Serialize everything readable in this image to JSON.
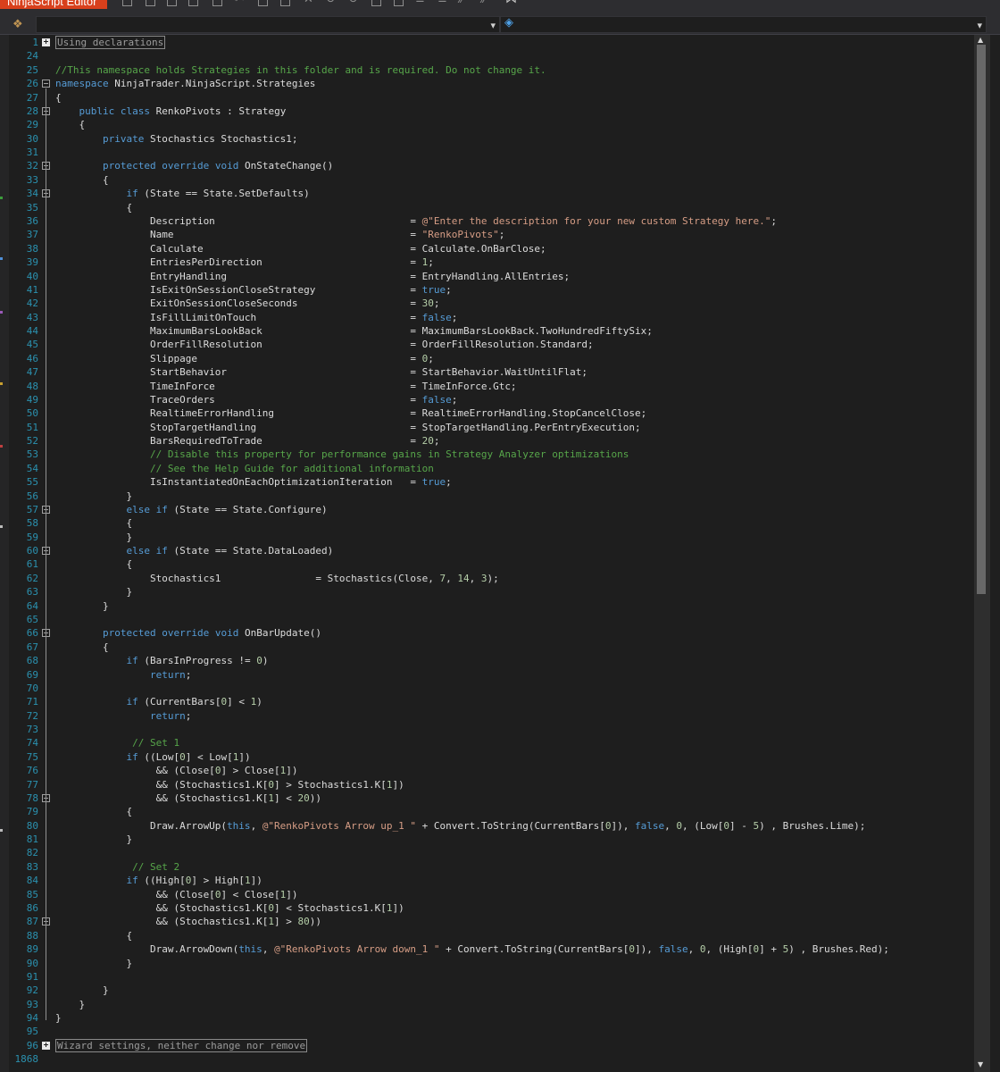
{
  "window": {
    "title": "NinjaScript Editor"
  },
  "toolbar_icons": [
    "new-icon",
    "open-icon",
    "save-icon",
    "save-all-icon",
    "templates-icon",
    "cut-icon",
    "copy-icon",
    "paste-icon",
    "delete-icon",
    "undo-icon",
    "redo-icon",
    "compile-icon",
    "calculator-icon",
    "comment-icon",
    "uncomment-icon",
    "indent-icon",
    "outdent-icon",
    "visual-studio-icon"
  ],
  "nav": {
    "left_icon": "class-icon",
    "member_icon": "method-icon"
  },
  "colors": {
    "keyword": "#569cd6",
    "comment": "#57a64a",
    "string": "#d69d85",
    "number": "#b5cea8",
    "line_number": "#2b91af",
    "text": "#dcdcdc",
    "background": "#1e1e1e",
    "title_accent": "#d8401c"
  },
  "code_lines": [
    {
      "n": "1",
      "fold": "plus",
      "t": [
        [
          "Using declarations",
          "collapsed"
        ]
      ]
    },
    {
      "n": "24",
      "t": []
    },
    {
      "n": "25",
      "t": [
        [
          "//This namespace holds Strategies in this folder and is required. Do not change it.",
          "cm"
        ]
      ]
    },
    {
      "n": "26",
      "fold": "minus",
      "t": [
        [
          "namespace",
          "kw"
        ],
        [
          " NinjaTrader.NinjaScript.Strategies",
          ""
        ]
      ]
    },
    {
      "n": "27",
      "t": [
        [
          "{",
          ""
        ]
      ]
    },
    {
      "n": "28",
      "fold": "minus",
      "t": [
        [
          "    ",
          ""
        ],
        [
          "public",
          "kw"
        ],
        [
          " ",
          ""
        ],
        [
          "class",
          "kw"
        ],
        [
          " RenkoPivots : Strategy",
          ""
        ]
      ]
    },
    {
      "n": "29",
      "t": [
        [
          "    {",
          ""
        ]
      ]
    },
    {
      "n": "30",
      "t": [
        [
          "        ",
          ""
        ],
        [
          "private",
          "kw"
        ],
        [
          " Stochastics Stochastics1;",
          ""
        ]
      ]
    },
    {
      "n": "31",
      "t": []
    },
    {
      "n": "32",
      "fold": "minus",
      "t": [
        [
          "        ",
          ""
        ],
        [
          "protected",
          "kw"
        ],
        [
          " ",
          ""
        ],
        [
          "override",
          "kw"
        ],
        [
          " ",
          ""
        ],
        [
          "void",
          "kw"
        ],
        [
          " OnStateChange()",
          ""
        ]
      ]
    },
    {
      "n": "33",
      "t": [
        [
          "        {",
          ""
        ]
      ]
    },
    {
      "n": "34",
      "fold": "minus",
      "t": [
        [
          "            ",
          ""
        ],
        [
          "if",
          "kw"
        ],
        [
          " (State == State.SetDefaults)",
          ""
        ]
      ]
    },
    {
      "n": "35",
      "t": [
        [
          "            {",
          ""
        ]
      ]
    },
    {
      "n": "36",
      "t": [
        [
          "                Description                                 = ",
          ""
        ],
        [
          "@\"Enter the description for your new custom Strategy here.\"",
          "st"
        ],
        [
          ";",
          ""
        ]
      ]
    },
    {
      "n": "37",
      "t": [
        [
          "                Name                                        = ",
          ""
        ],
        [
          "\"RenkoPivots\"",
          "st"
        ],
        [
          ";",
          ""
        ]
      ]
    },
    {
      "n": "38",
      "t": [
        [
          "                Calculate                                   = Calculate.OnBarClose;",
          ""
        ]
      ]
    },
    {
      "n": "39",
      "t": [
        [
          "                EntriesPerDirection                         = ",
          ""
        ],
        [
          "1",
          "nm"
        ],
        [
          ";",
          ""
        ]
      ]
    },
    {
      "n": "40",
      "t": [
        [
          "                EntryHandling                               = EntryHandling.AllEntries;",
          ""
        ]
      ]
    },
    {
      "n": "41",
      "t": [
        [
          "                IsExitOnSessionCloseStrategy                = ",
          ""
        ],
        [
          "true",
          "kw"
        ],
        [
          ";",
          ""
        ]
      ]
    },
    {
      "n": "42",
      "t": [
        [
          "                ExitOnSessionCloseSeconds                   = ",
          ""
        ],
        [
          "30",
          "nm"
        ],
        [
          ";",
          ""
        ]
      ]
    },
    {
      "n": "43",
      "t": [
        [
          "                IsFillLimitOnTouch                          = ",
          ""
        ],
        [
          "false",
          "kw"
        ],
        [
          ";",
          ""
        ]
      ]
    },
    {
      "n": "44",
      "t": [
        [
          "                MaximumBarsLookBack                         = MaximumBarsLookBack.TwoHundredFiftySix;",
          ""
        ]
      ]
    },
    {
      "n": "45",
      "t": [
        [
          "                OrderFillResolution                         = OrderFillResolution.Standard;",
          ""
        ]
      ]
    },
    {
      "n": "46",
      "t": [
        [
          "                Slippage                                    = ",
          ""
        ],
        [
          "0",
          "nm"
        ],
        [
          ";",
          ""
        ]
      ]
    },
    {
      "n": "47",
      "t": [
        [
          "                StartBehavior                               = StartBehavior.WaitUntilFlat;",
          ""
        ]
      ]
    },
    {
      "n": "48",
      "t": [
        [
          "                TimeInForce                                 = TimeInForce.Gtc;",
          ""
        ]
      ]
    },
    {
      "n": "49",
      "t": [
        [
          "                TraceOrders                                 = ",
          ""
        ],
        [
          "false",
          "kw"
        ],
        [
          ";",
          ""
        ]
      ]
    },
    {
      "n": "50",
      "t": [
        [
          "                RealtimeErrorHandling                       = RealtimeErrorHandling.StopCancelClose;",
          ""
        ]
      ]
    },
    {
      "n": "51",
      "t": [
        [
          "                StopTargetHandling                          = StopTargetHandling.PerEntryExecution;",
          ""
        ]
      ]
    },
    {
      "n": "52",
      "t": [
        [
          "                BarsRequiredToTrade                         = ",
          ""
        ],
        [
          "20",
          "nm"
        ],
        [
          ";",
          ""
        ]
      ]
    },
    {
      "n": "53",
      "t": [
        [
          "                ",
          ""
        ],
        [
          "// Disable this property for performance gains in Strategy Analyzer optimizations",
          "cm"
        ]
      ]
    },
    {
      "n": "54",
      "t": [
        [
          "                ",
          ""
        ],
        [
          "// See the Help Guide for additional information",
          "cm"
        ]
      ]
    },
    {
      "n": "55",
      "t": [
        [
          "                IsInstantiatedOnEachOptimizationIteration   = ",
          ""
        ],
        [
          "true",
          "kw"
        ],
        [
          ";",
          ""
        ]
      ]
    },
    {
      "n": "56",
      "t": [
        [
          "            }",
          ""
        ]
      ]
    },
    {
      "n": "57",
      "fold": "minus",
      "t": [
        [
          "            ",
          ""
        ],
        [
          "else",
          "kw"
        ],
        [
          " ",
          ""
        ],
        [
          "if",
          "kw"
        ],
        [
          " (State == State.Configure)",
          ""
        ]
      ]
    },
    {
      "n": "58",
      "t": [
        [
          "            {",
          ""
        ]
      ]
    },
    {
      "n": "59",
      "t": [
        [
          "            }",
          ""
        ]
      ]
    },
    {
      "n": "60",
      "fold": "minus",
      "t": [
        [
          "            ",
          ""
        ],
        [
          "else",
          "kw"
        ],
        [
          " ",
          ""
        ],
        [
          "if",
          "kw"
        ],
        [
          " (State == State.DataLoaded)",
          ""
        ]
      ]
    },
    {
      "n": "61",
      "t": [
        [
          "            {",
          ""
        ]
      ]
    },
    {
      "n": "62",
      "t": [
        [
          "                Stochastics1                = Stochastics(Close, ",
          ""
        ],
        [
          "7",
          "nm"
        ],
        [
          ", ",
          ""
        ],
        [
          "14",
          "nm"
        ],
        [
          ", ",
          ""
        ],
        [
          "3",
          "nm"
        ],
        [
          ");",
          ""
        ]
      ]
    },
    {
      "n": "63",
      "t": [
        [
          "            }",
          ""
        ]
      ]
    },
    {
      "n": "64",
      "t": [
        [
          "        }",
          ""
        ]
      ]
    },
    {
      "n": "65",
      "t": []
    },
    {
      "n": "66",
      "fold": "minus",
      "t": [
        [
          "        ",
          ""
        ],
        [
          "protected",
          "kw"
        ],
        [
          " ",
          ""
        ],
        [
          "override",
          "kw"
        ],
        [
          " ",
          ""
        ],
        [
          "void",
          "kw"
        ],
        [
          " OnBarUpdate()",
          ""
        ]
      ]
    },
    {
      "n": "67",
      "t": [
        [
          "        {",
          ""
        ]
      ]
    },
    {
      "n": "68",
      "t": [
        [
          "            ",
          ""
        ],
        [
          "if",
          "kw"
        ],
        [
          " (BarsInProgress != ",
          ""
        ],
        [
          "0",
          "nm"
        ],
        [
          ")",
          ""
        ]
      ]
    },
    {
      "n": "69",
      "t": [
        [
          "                ",
          ""
        ],
        [
          "return",
          "kw"
        ],
        [
          ";",
          ""
        ]
      ]
    },
    {
      "n": "70",
      "t": []
    },
    {
      "n": "71",
      "t": [
        [
          "            ",
          ""
        ],
        [
          "if",
          "kw"
        ],
        [
          " (CurrentBars[",
          ""
        ],
        [
          "0",
          "nm"
        ],
        [
          "] < ",
          ""
        ],
        [
          "1",
          "nm"
        ],
        [
          ")",
          ""
        ]
      ]
    },
    {
      "n": "72",
      "t": [
        [
          "                ",
          ""
        ],
        [
          "return",
          "kw"
        ],
        [
          ";",
          ""
        ]
      ]
    },
    {
      "n": "73",
      "t": []
    },
    {
      "n": "74",
      "t": [
        [
          "             ",
          ""
        ],
        [
          "// Set 1",
          "cm"
        ]
      ]
    },
    {
      "n": "75",
      "t": [
        [
          "            ",
          ""
        ],
        [
          "if",
          "kw"
        ],
        [
          " ((Low[",
          ""
        ],
        [
          "0",
          "nm"
        ],
        [
          "] < Low[",
          ""
        ],
        [
          "1",
          "nm"
        ],
        [
          "])",
          ""
        ]
      ]
    },
    {
      "n": "76",
      "t": [
        [
          "                 && (Close[",
          ""
        ],
        [
          "0",
          "nm"
        ],
        [
          "] > Close[",
          ""
        ],
        [
          "1",
          "nm"
        ],
        [
          "])",
          ""
        ]
      ]
    },
    {
      "n": "77",
      "t": [
        [
          "                 && (Stochastics1.K[",
          ""
        ],
        [
          "0",
          "nm"
        ],
        [
          "] > Stochastics1.K[",
          ""
        ],
        [
          "1",
          "nm"
        ],
        [
          "])",
          ""
        ]
      ]
    },
    {
      "n": "78",
      "fold": "minus",
      "t": [
        [
          "                 && (Stochastics1.K[",
          ""
        ],
        [
          "1",
          "nm"
        ],
        [
          "] < ",
          ""
        ],
        [
          "20",
          "nm"
        ],
        [
          "))",
          ""
        ]
      ]
    },
    {
      "n": "79",
      "t": [
        [
          "            {",
          ""
        ]
      ]
    },
    {
      "n": "80",
      "t": [
        [
          "                Draw.ArrowUp(",
          ""
        ],
        [
          "this",
          "kw"
        ],
        [
          ", ",
          ""
        ],
        [
          "@\"RenkoPivots Arrow up_1 \"",
          "st"
        ],
        [
          " + Convert.ToString(CurrentBars[",
          ""
        ],
        [
          "0",
          "nm"
        ],
        [
          "]), ",
          ""
        ],
        [
          "false",
          "kw"
        ],
        [
          ", ",
          ""
        ],
        [
          "0",
          "nm"
        ],
        [
          ", (Low[",
          ""
        ],
        [
          "0",
          "nm"
        ],
        [
          "] - ",
          ""
        ],
        [
          "5",
          "nm"
        ],
        [
          ") , Brushes.Lime);",
          ""
        ]
      ]
    },
    {
      "n": "81",
      "t": [
        [
          "            }",
          ""
        ]
      ]
    },
    {
      "n": "82",
      "t": []
    },
    {
      "n": "83",
      "t": [
        [
          "             ",
          ""
        ],
        [
          "// Set 2",
          "cm"
        ]
      ]
    },
    {
      "n": "84",
      "t": [
        [
          "            ",
          ""
        ],
        [
          "if",
          "kw"
        ],
        [
          " ((High[",
          ""
        ],
        [
          "0",
          "nm"
        ],
        [
          "] > High[",
          ""
        ],
        [
          "1",
          "nm"
        ],
        [
          "])",
          ""
        ]
      ]
    },
    {
      "n": "85",
      "t": [
        [
          "                 && (Close[",
          ""
        ],
        [
          "0",
          "nm"
        ],
        [
          "] < Close[",
          ""
        ],
        [
          "1",
          "nm"
        ],
        [
          "])",
          ""
        ]
      ]
    },
    {
      "n": "86",
      "t": [
        [
          "                 && (Stochastics1.K[",
          ""
        ],
        [
          "0",
          "nm"
        ],
        [
          "] < Stochastics1.K[",
          ""
        ],
        [
          "1",
          "nm"
        ],
        [
          "])",
          ""
        ]
      ]
    },
    {
      "n": "87",
      "fold": "minus",
      "t": [
        [
          "                 && (Stochastics1.K[",
          ""
        ],
        [
          "1",
          "nm"
        ],
        [
          "] > ",
          ""
        ],
        [
          "80",
          "nm"
        ],
        [
          "))",
          ""
        ]
      ]
    },
    {
      "n": "88",
      "t": [
        [
          "            {",
          ""
        ]
      ]
    },
    {
      "n": "89",
      "t": [
        [
          "                Draw.ArrowDown(",
          ""
        ],
        [
          "this",
          "kw"
        ],
        [
          ", ",
          ""
        ],
        [
          "@\"RenkoPivots Arrow down_1 \"",
          "st"
        ],
        [
          " + Convert.ToString(CurrentBars[",
          ""
        ],
        [
          "0",
          "nm"
        ],
        [
          "]), ",
          ""
        ],
        [
          "false",
          "kw"
        ],
        [
          ", ",
          ""
        ],
        [
          "0",
          "nm"
        ],
        [
          ", (High[",
          ""
        ],
        [
          "0",
          "nm"
        ],
        [
          "] + ",
          ""
        ],
        [
          "5",
          "nm"
        ],
        [
          ") , Brushes.Red);",
          ""
        ]
      ]
    },
    {
      "n": "90",
      "t": [
        [
          "            }",
          ""
        ]
      ]
    },
    {
      "n": "91",
      "t": []
    },
    {
      "n": "92",
      "t": [
        [
          "        }",
          ""
        ]
      ]
    },
    {
      "n": "93",
      "t": [
        [
          "    }",
          ""
        ]
      ]
    },
    {
      "n": "94",
      "t": [
        [
          "}",
          ""
        ]
      ]
    },
    {
      "n": "95",
      "t": []
    },
    {
      "n": "96",
      "fold": "plus",
      "t": [
        [
          "Wizard settings, neither change nor remove",
          "collapsed"
        ]
      ]
    },
    {
      "n": "1868",
      "t": []
    }
  ]
}
